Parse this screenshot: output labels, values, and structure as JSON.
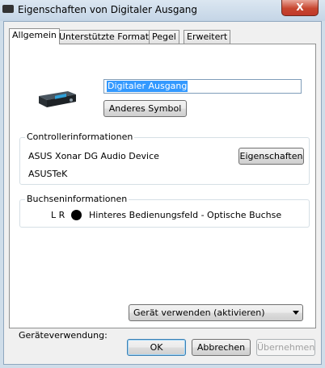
{
  "window": {
    "title": "Eigenschaften von Digitaler Ausgang",
    "close_label": "X"
  },
  "tabs": [
    {
      "label": "Allgemein"
    },
    {
      "label": "Unterstützte Formate"
    },
    {
      "label": "Pegel"
    },
    {
      "label": "Erweitert"
    }
  ],
  "general": {
    "device_name": "Digitaler Ausgang",
    "change_icon_label": "Anderes Symbol"
  },
  "controller": {
    "group_title": "Controllerinformationen",
    "device": "ASUS Xonar DG Audio Device",
    "vendor": "ASUSTeK",
    "properties_label": "Eigenschaften"
  },
  "jack": {
    "group_title": "Buchseninformationen",
    "channels": "L R",
    "jack_color": "#000000",
    "description": "Hinteres Bedienungsfeld - Optische Buchse"
  },
  "usage": {
    "label": "Geräteverwendung:",
    "selected": "Gerät verwenden (aktivieren)"
  },
  "footer": {
    "ok_label": "OK",
    "cancel_label": "Abbrechen",
    "apply_label": "Übernehmen"
  }
}
